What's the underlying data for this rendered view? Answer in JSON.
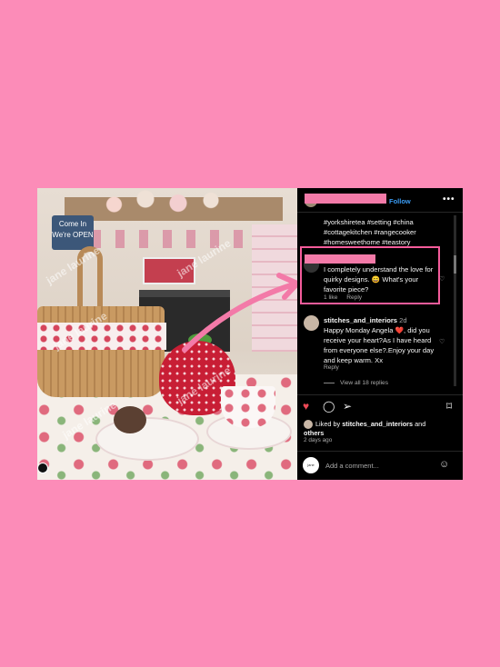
{
  "post": {
    "follow_label": "Follow",
    "more_label": "•••",
    "caption_hashtags": "#yorkshiretea #setting #china #cottagekitchen #rangecooker #homesweethome #teastory",
    "highlighted_comment": {
      "text": "I completely understand the love for quirky designs. 😄 What's your favorite piece?",
      "likes": "1 like",
      "reply_label": "Reply"
    },
    "reply": {
      "username": "stitches_and_interiors",
      "age": "2d",
      "text": "Happy Monday Angela ❤️, did you receive your heart?As I have heard from everyone else?.Enjoy your day and keep warm. Xx",
      "reply_label": "Reply",
      "view_replies": "View all 18 replies"
    },
    "liked_by_prefix": "Liked by",
    "liked_by_user": "stitches_and_interiors",
    "liked_by_conj": "and",
    "liked_by_others": "others",
    "timestamp": "2 days ago",
    "add_comment_placeholder": "Add a comment...",
    "avatar_small_text": "jane laurine"
  },
  "photo": {
    "watermark": "jane laurine",
    "sign_text": "Come In We're OPEN"
  },
  "colors": {
    "background": "#fc8cb8",
    "highlight_border": "#f45c9b",
    "follow_blue": "#3b9cf4",
    "heart_red": "#ed4956"
  },
  "icons": [
    "heart-filled-icon",
    "comment-icon",
    "share-icon",
    "bookmark-icon",
    "smiley-icon",
    "ellipsis-icon"
  ]
}
